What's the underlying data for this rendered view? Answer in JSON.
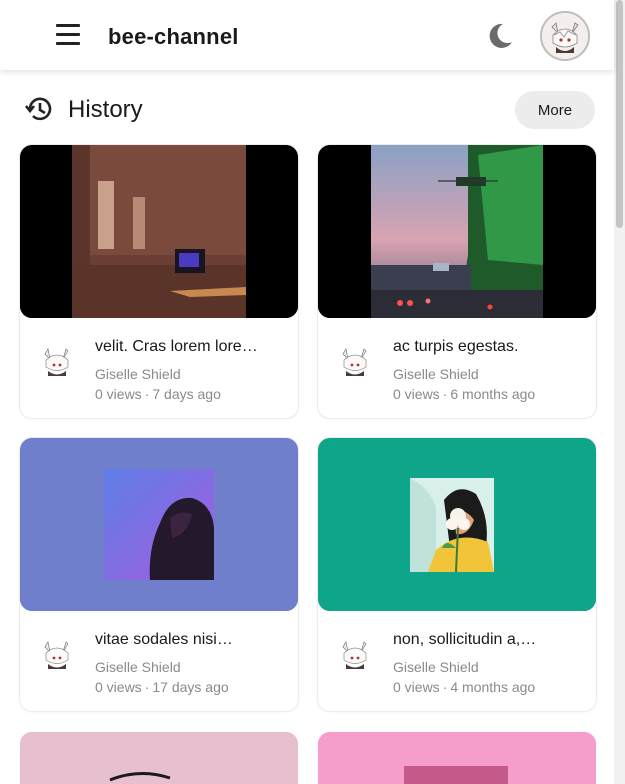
{
  "header": {
    "brand": "bee-channel",
    "menu_icon": "hamburger-menu-icon",
    "theme_icon": "moon-icon"
  },
  "history": {
    "title": "History",
    "more_label": "More",
    "icon": "history-clock-icon"
  },
  "videos": [
    {
      "title": "velit. Cras lorem lore…",
      "channel": "Giselle Shield",
      "views": "0 views",
      "age": "7 days ago",
      "thumb_bg": "#000000"
    },
    {
      "title": "ac turpis egestas.",
      "channel": "Giselle Shield",
      "views": "0 views",
      "age": "6 months ago",
      "thumb_bg": "#000000"
    },
    {
      "title": "vitae sodales nisi…",
      "channel": "Giselle Shield",
      "views": "0 views",
      "age": "17 days ago",
      "thumb_bg": "#6f7fcc"
    },
    {
      "title": "non, sollicitudin a,…",
      "channel": "Giselle Shield",
      "views": "0 views",
      "age": "4 months ago",
      "thumb_bg": "#0fa58a"
    }
  ],
  "partial_thumbs": [
    "#e8bfce",
    "#f59ecb"
  ],
  "meta_separator": "·"
}
